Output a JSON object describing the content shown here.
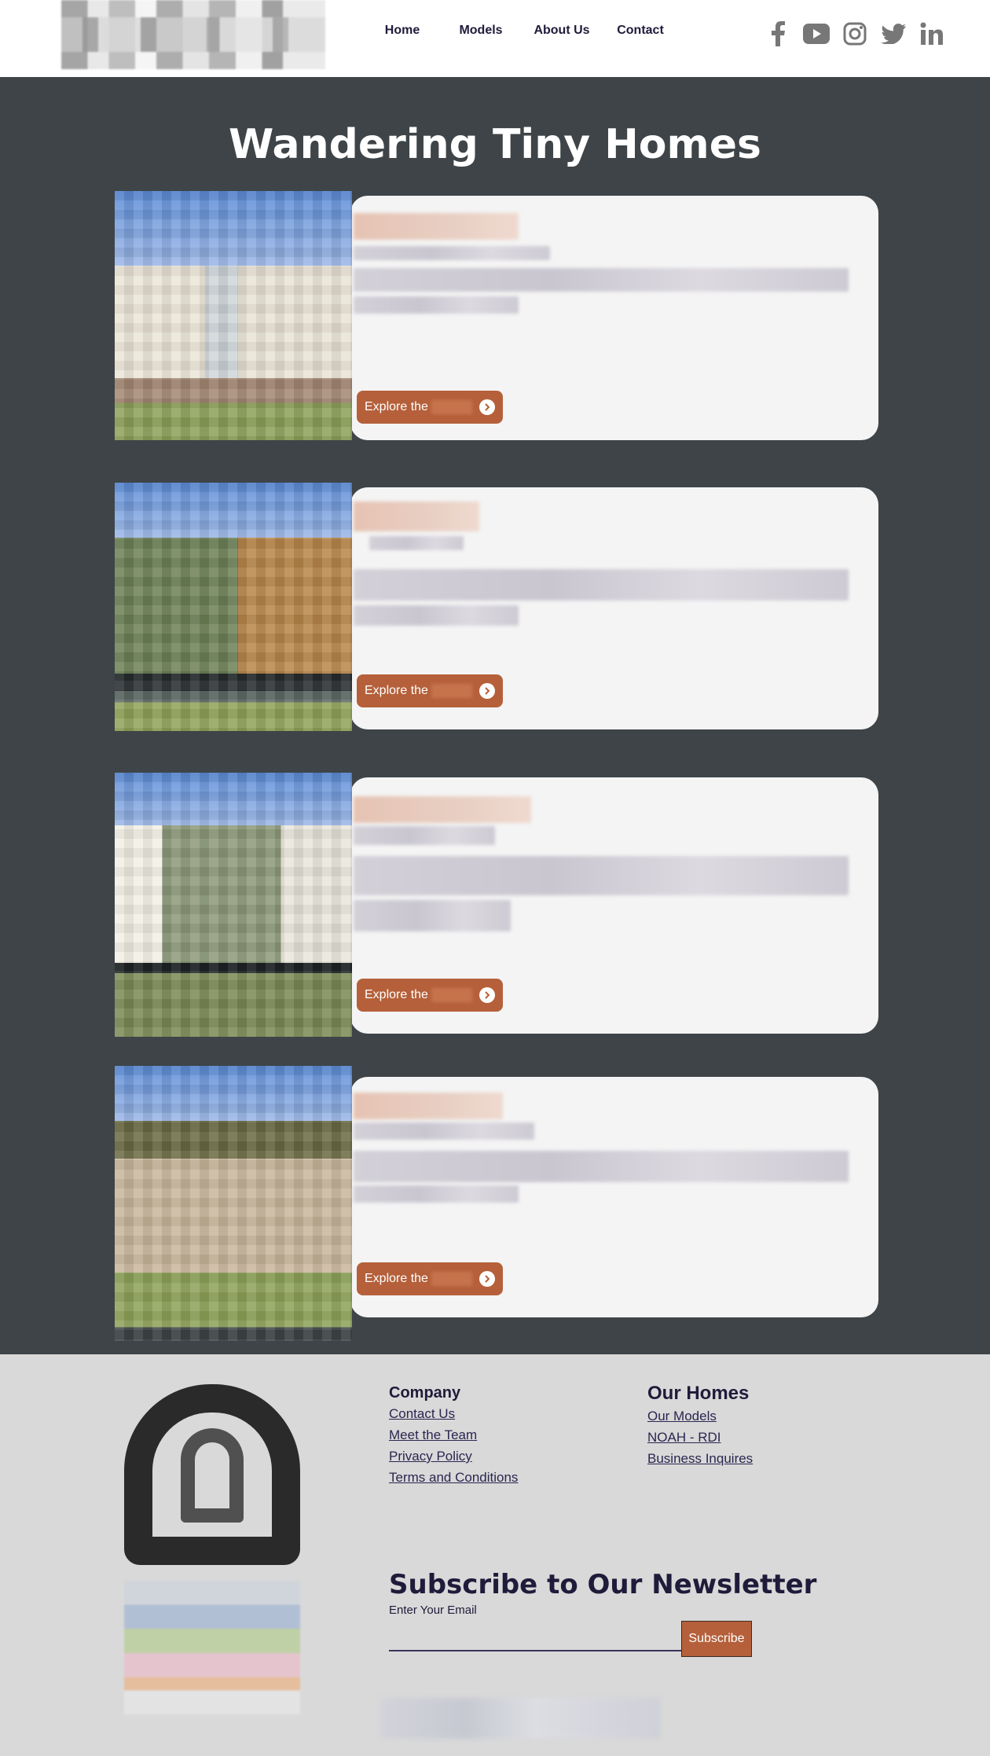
{
  "header": {
    "nav": [
      "Home",
      "Models",
      "About Us",
      "Contact"
    ],
    "social_icons": [
      "facebook-icon",
      "youtube-icon",
      "instagram-icon",
      "twitter-icon",
      "linkedin-icon"
    ]
  },
  "main": {
    "title": "Wandering Tiny Homes",
    "cards": [
      {
        "button_label": "Explore the"
      },
      {
        "button_label": "Explore the"
      },
      {
        "button_label": "Explore the"
      },
      {
        "button_label": "Explore the"
      }
    ]
  },
  "footer": {
    "company": {
      "title": "Company",
      "links": [
        "Contact Us",
        "Meet the Team",
        "Privacy Policy",
        "Terms and Conditions"
      ]
    },
    "homes": {
      "title": "Our Homes",
      "links": [
        "Our Models",
        "NOAH - RDI",
        "Business Inquires"
      ]
    },
    "newsletter": {
      "title": "Subscribe to Our Newsletter",
      "email_label": "Enter Your Email",
      "subscribe_label": "Subscribe"
    }
  },
  "colors": {
    "dark_bg": "#3e4447",
    "accent": "#b5603a",
    "card_bg": "#f4f4f4",
    "footer_bg": "#d9d9d9",
    "text_dark": "#1f1b3a"
  }
}
